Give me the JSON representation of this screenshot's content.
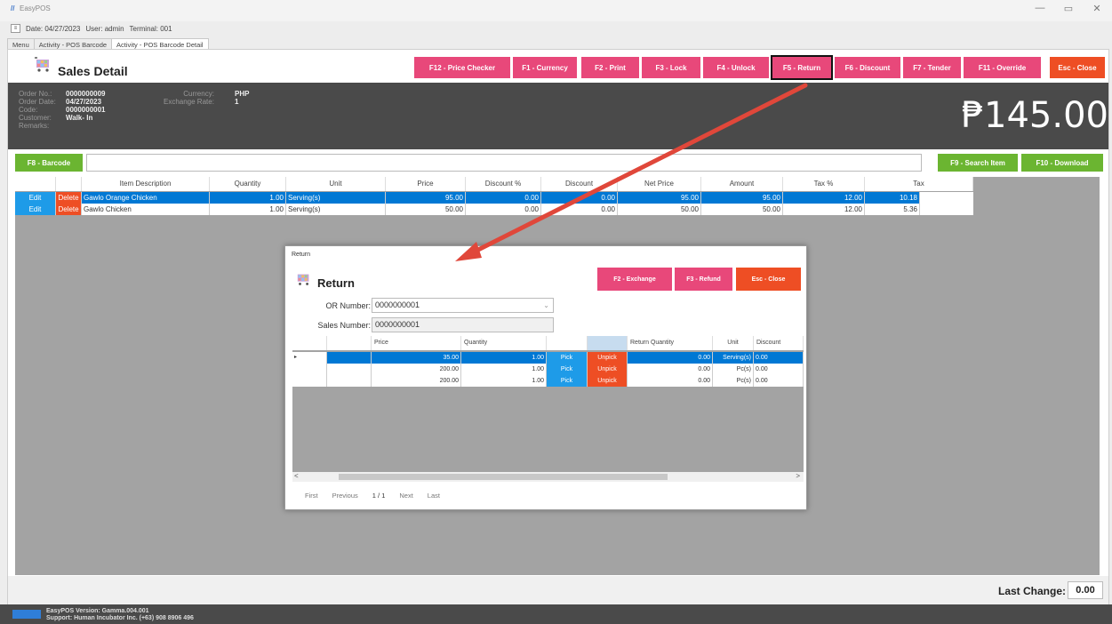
{
  "window": {
    "logo": "//",
    "app_name": "EasyPOS",
    "minimize": "—",
    "restore": "▭",
    "close": "✕"
  },
  "info": {
    "menu_icon": "≡",
    "date": "Date: 04/27/2023",
    "user": "User: admin",
    "terminal": "Terminal: 001"
  },
  "tabs": [
    "Menu",
    "Activity - POS Barcode",
    "Activity - POS Barcode Detail"
  ],
  "header": {
    "title": "Sales Detail",
    "buttons": {
      "price_checker": "F12 - Price Checker",
      "currency": "F1 - Currency",
      "print": "F2 - Print",
      "lock": "F3 - Lock",
      "unlock": "F4 - Unlock",
      "return": "F5 - Return",
      "discount": "F6 - Discount",
      "tender": "F7 - Tender",
      "override": "F11 - Override",
      "close": "Esc - Close"
    }
  },
  "order": {
    "labels": {
      "order_no": "Order No.:",
      "order_date": "Order Date:",
      "code": "Code:",
      "customer": "Customer:",
      "remarks": "Remarks:",
      "currency": "Currency:",
      "exchange_rate": "Exchange Rate:"
    },
    "order_no": "0000000009",
    "order_date": "04/27/2023",
    "code": "0000000001",
    "customer": "Walk- In",
    "remarks": "",
    "currency": "PHP",
    "exchange_rate": "1",
    "total": "₱145.00"
  },
  "barcode": {
    "barcode_button": "F8 - Barcode",
    "search_button": "F9 - Search Item",
    "download_button": "F10 - Download",
    "value": ""
  },
  "grid": {
    "columns": [
      "",
      "",
      "Item Description",
      "Quantity",
      "Unit",
      "Price",
      "Discount %",
      "Discount",
      "Net Price",
      "Amount",
      "Tax %",
      "Tax"
    ],
    "rows": [
      {
        "edit": "Edit",
        "delete": "Delete",
        "item": "Gawlo Orange Chicken",
        "qty": "1.00",
        "unit": "Serving(s)",
        "price": "95.00",
        "disc_pct": "0.00",
        "disc": "0.00",
        "net": "95.00",
        "amount": "95.00",
        "tax_pct": "12.00",
        "tax": "10.18"
      },
      {
        "edit": "Edit",
        "delete": "Delete",
        "item": "Gawlo Chicken",
        "qty": "1.00",
        "unit": "Serving(s)",
        "price": "50.00",
        "disc_pct": "0.00",
        "disc": "0.00",
        "net": "50.00",
        "amount": "50.00",
        "tax_pct": "12.00",
        "tax": "5.36"
      }
    ]
  },
  "last_change": {
    "label": "Last Change:",
    "value": "0.00"
  },
  "status": {
    "version": "EasyPOS Version: Gamma.004.001",
    "support": "Support: Human Incubator Inc. (+63) 908 8906 496"
  },
  "return_dialog": {
    "window_title": "Return",
    "heading": "Return",
    "buttons": {
      "exchange": "F2 - Exchange",
      "refund": "F3 - Refund",
      "close": "Esc - Close"
    },
    "or_label": "OR Number:",
    "or_value": "0000000001",
    "sales_label": "Sales Number:",
    "sales_value": "0000000001",
    "columns": [
      "",
      "",
      "Price",
      "Quantity",
      "",
      "",
      "Return Quantity",
      "Unit",
      "Discount"
    ],
    "rows": [
      {
        "marker": "▸",
        "price": "35.00",
        "qty": "1.00",
        "pick": "Pick",
        "unpick": "Unpick",
        "ret_qty": "0.00",
        "unit": "Serving(s)",
        "disc": "0.00"
      },
      {
        "marker": "",
        "price": "200.00",
        "qty": "1.00",
        "pick": "Pick",
        "unpick": "Unpick",
        "ret_qty": "0.00",
        "unit": "Pc(s)",
        "disc": "0.00"
      },
      {
        "marker": "",
        "price": "200.00",
        "qty": "1.00",
        "pick": "Pick",
        "unpick": "Unpick",
        "ret_qty": "0.00",
        "unit": "Pc(s)",
        "disc": "0.00"
      }
    ],
    "pager": {
      "first": "First",
      "previous": "Previous",
      "page": "1 / 1",
      "next": "Next",
      "last": "Last"
    },
    "scroll_left": "<",
    "scroll_right": ">"
  },
  "colors": {
    "pink": "#e8487a",
    "orange": "#ee4e24",
    "green": "#6bb531",
    "selection": "#0078d4",
    "dark_panel": "#4a4a4a",
    "annotation_arrow": "#e0473a"
  }
}
